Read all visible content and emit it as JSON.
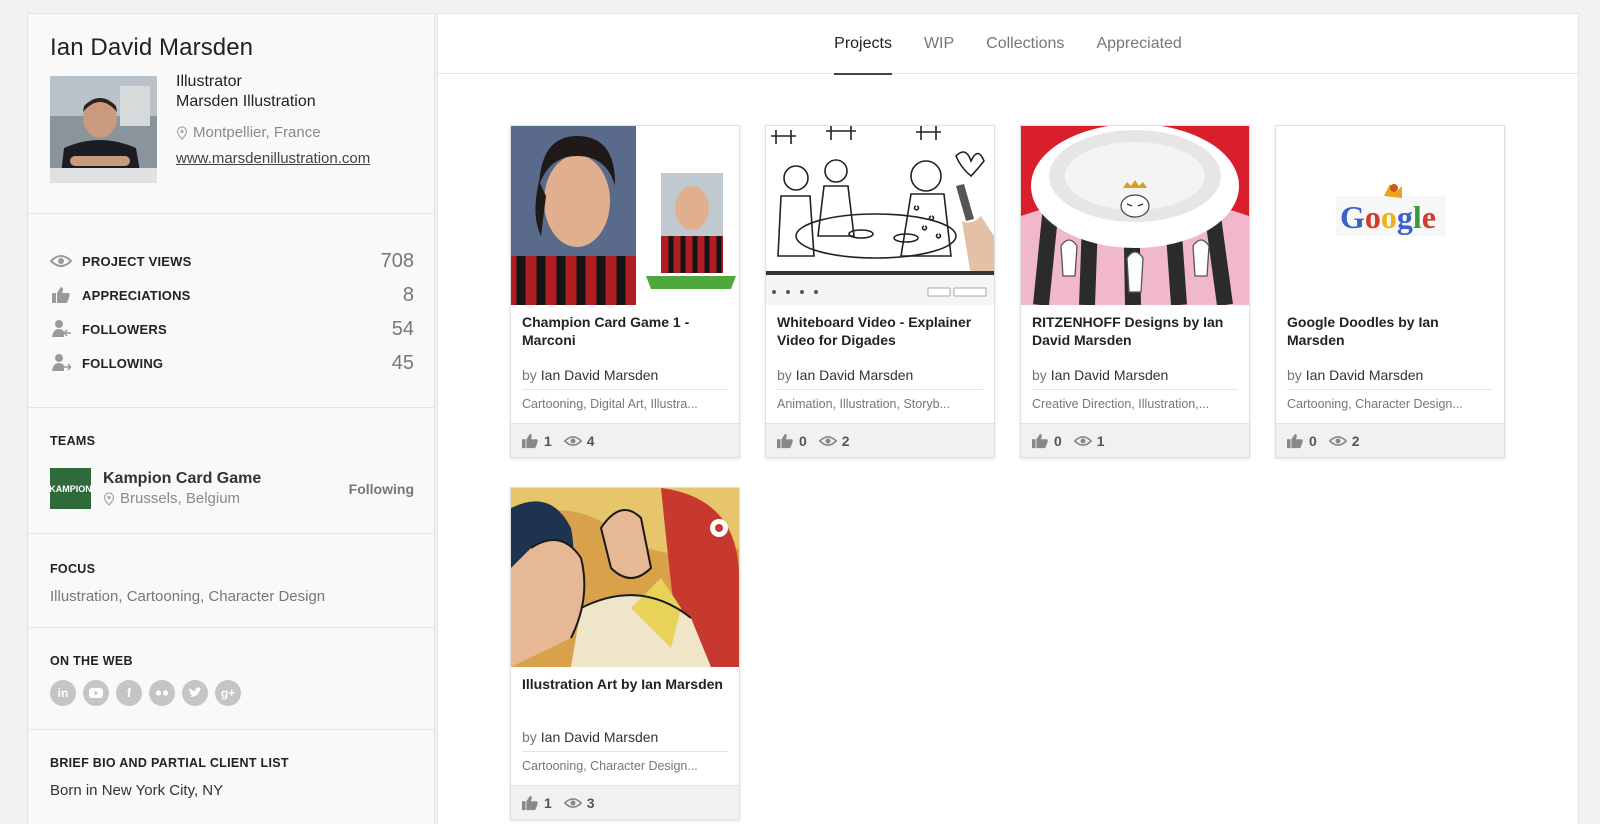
{
  "profile": {
    "name": "Ian David Marsden",
    "occupation": "Illustrator",
    "company": "Marsden Illustration",
    "location": "Montpellier, France",
    "website": "www.marsdenillustration.com"
  },
  "stats": [
    {
      "label": "PROJECT VIEWS",
      "value": "708",
      "icon": "eye-icon"
    },
    {
      "label": "APPRECIATIONS",
      "value": "8",
      "icon": "thumbs-up-icon"
    },
    {
      "label": "FOLLOWERS",
      "value": "54",
      "icon": "followers-icon"
    },
    {
      "label": "FOLLOWING",
      "value": "45",
      "icon": "following-icon"
    }
  ],
  "teams": {
    "heading": "TEAMS",
    "team_name": "Kampion Card Game",
    "team_location": "Brussels, Belgium",
    "team_logo_text": "KAMPION",
    "follow_label": "Following"
  },
  "focus": {
    "heading": "FOCUS",
    "items": "Illustration, Cartooning, Character Design"
  },
  "web": {
    "heading": "ON THE WEB",
    "icons": [
      "linkedin-icon",
      "youtube-icon",
      "facebook-icon",
      "flickr-icon",
      "twitter-icon",
      "google-plus-icon"
    ]
  },
  "bio": {
    "heading": "BRIEF BIO AND PARTIAL CLIENT LIST",
    "text": "Born in New York City, NY"
  },
  "tabs": [
    "Projects",
    "WIP",
    "Collections",
    "Appreciated"
  ],
  "projects": [
    {
      "title": "Champion Card Game 1 - Marconi",
      "by": "by",
      "owner": "Ian David Marsden",
      "fields": "Cartooning, Digital Art, Illustra...",
      "appreciations": "1",
      "views": "4"
    },
    {
      "title": "Whiteboard Video - Explainer Video for Digades",
      "by": "by",
      "owner": "Ian David Marsden",
      "fields": "Animation, Illustration, Storyb...",
      "appreciations": "0",
      "views": "2"
    },
    {
      "title": "RITZENHOFF Designs by Ian David Marsden",
      "by": "by",
      "owner": "Ian David Marsden",
      "fields": "Creative Direction, Illustration,...",
      "appreciations": "0",
      "views": "1"
    },
    {
      "title": "Google Doodles by Ian Marsden",
      "by": "by",
      "owner": "Ian David Marsden",
      "fields": "Cartooning, Character Design...",
      "appreciations": "0",
      "views": "2",
      "logo_text": "Google"
    },
    {
      "title": "Illustration Art by Ian Marsden",
      "by": "by",
      "owner": "Ian David Marsden",
      "fields": "Cartooning, Character Design...",
      "appreciations": "1",
      "views": "3"
    }
  ],
  "colors": {
    "accent": "#222222",
    "muted": "#777777",
    "sidebar_bg": "#f9f9f9"
  }
}
